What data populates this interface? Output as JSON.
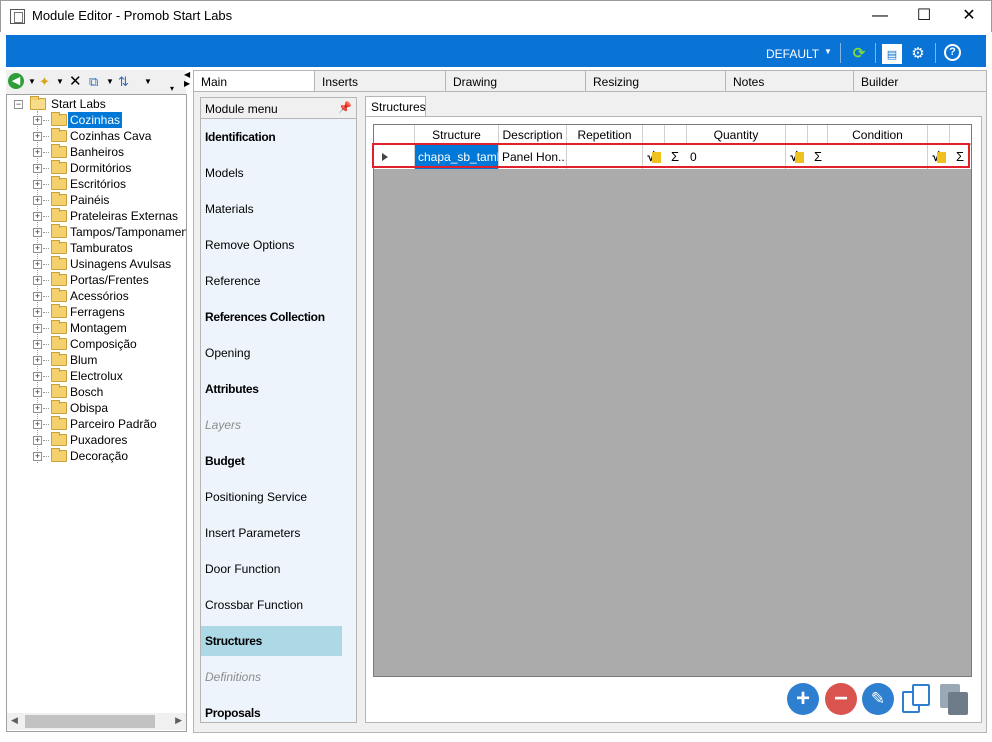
{
  "window": {
    "title": "Module Editor - Promob Start Labs",
    "minimize": "—",
    "maximize": "☐",
    "close": "✕"
  },
  "ribbon": {
    "profile": "DEFAULT"
  },
  "tree": {
    "root": "Start Labs",
    "items": [
      {
        "label": "Cozinhas",
        "selected": true
      },
      {
        "label": "Cozinhas Cava"
      },
      {
        "label": "Banheiros"
      },
      {
        "label": "Dormitórios"
      },
      {
        "label": "Escritórios"
      },
      {
        "label": "Painéis"
      },
      {
        "label": "Prateleiras Externas"
      },
      {
        "label": "Tampos/Tamponamen"
      },
      {
        "label": "Tamburatos"
      },
      {
        "label": "Usinagens Avulsas"
      },
      {
        "label": "Portas/Frentes"
      },
      {
        "label": "Acessórios"
      },
      {
        "label": "Ferragens"
      },
      {
        "label": "Montagem"
      },
      {
        "label": "Composição"
      },
      {
        "label": "Blum"
      },
      {
        "label": "Electrolux"
      },
      {
        "label": "Bosch"
      },
      {
        "label": "Obispa"
      },
      {
        "label": "Parceiro Padrão"
      },
      {
        "label": "Puxadores"
      },
      {
        "label": "Decoração"
      }
    ]
  },
  "tabs": [
    "Main",
    "Inserts",
    "Drawing",
    "Resizing",
    "Notes",
    "Builder"
  ],
  "module_menu": {
    "header": "Module menu",
    "items": [
      {
        "label": "Identification",
        "style": "bold"
      },
      {
        "label": "Models",
        "style": "normal"
      },
      {
        "label": "Materials",
        "style": "normal"
      },
      {
        "label": "Remove Options",
        "style": "normal"
      },
      {
        "label": "Reference",
        "style": "normal"
      },
      {
        "label": "References Collection",
        "style": "bold"
      },
      {
        "label": "Opening",
        "style": "normal"
      },
      {
        "label": "Attributes",
        "style": "bold"
      },
      {
        "label": "Layers",
        "style": "disabled"
      },
      {
        "label": "Budget",
        "style": "bold"
      },
      {
        "label": "Positioning Service",
        "style": "normal"
      },
      {
        "label": "Insert Parameters",
        "style": "normal"
      },
      {
        "label": "Door Function",
        "style": "normal"
      },
      {
        "label": "Crossbar Function",
        "style": "normal"
      },
      {
        "label": "Structures",
        "style": "bold",
        "selected": true
      },
      {
        "label": "Definitions",
        "style": "disabled"
      },
      {
        "label": "Proposals",
        "style": "bold"
      }
    ]
  },
  "structures": {
    "tab_label": "Structures",
    "columns": [
      "Structure",
      "Description",
      "Repetition",
      "Quantity",
      "Condition"
    ],
    "rows": [
      {
        "structure": "chapa_sb_tamb",
        "description": "Panel Hon...",
        "repetition": "",
        "quantity": "0",
        "condition": ""
      }
    ],
    "sqrt_symbol": "√",
    "sigma_symbol": "Σ"
  },
  "actions": {
    "add": "+",
    "remove": "−"
  }
}
